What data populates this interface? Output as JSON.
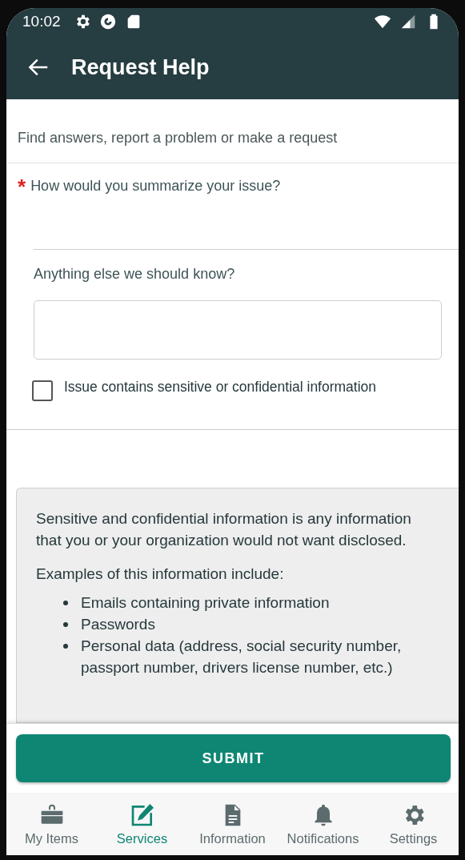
{
  "status_bar": {
    "time": "10:02"
  },
  "app_bar": {
    "title": "Request Help"
  },
  "intro": "Find answers, report a problem or make a request",
  "summary_field": {
    "required_mark": "*",
    "label": "How would you summarize your issue?"
  },
  "details_field": {
    "label": "Anything else we should know?"
  },
  "sensitive_checkbox": {
    "label": "Issue contains sensitive or confidential information",
    "checked": false
  },
  "info_box": {
    "paragraphs": [
      "Sensitive and confidential information is any information that you or your organization would not want disclosed.",
      "Examples of this information include:"
    ],
    "bullets": [
      "Emails containing private information",
      "Passwords",
      "Personal data (address, social security number, passport number, drivers license number, etc.)"
    ]
  },
  "submit_button": "SUBMIT",
  "bottom_nav": [
    {
      "label": "My Items",
      "selected": false
    },
    {
      "label": "Services",
      "selected": true
    },
    {
      "label": "Information",
      "selected": false
    },
    {
      "label": "Notifications",
      "selected": false
    },
    {
      "label": "Settings",
      "selected": false
    }
  ]
}
